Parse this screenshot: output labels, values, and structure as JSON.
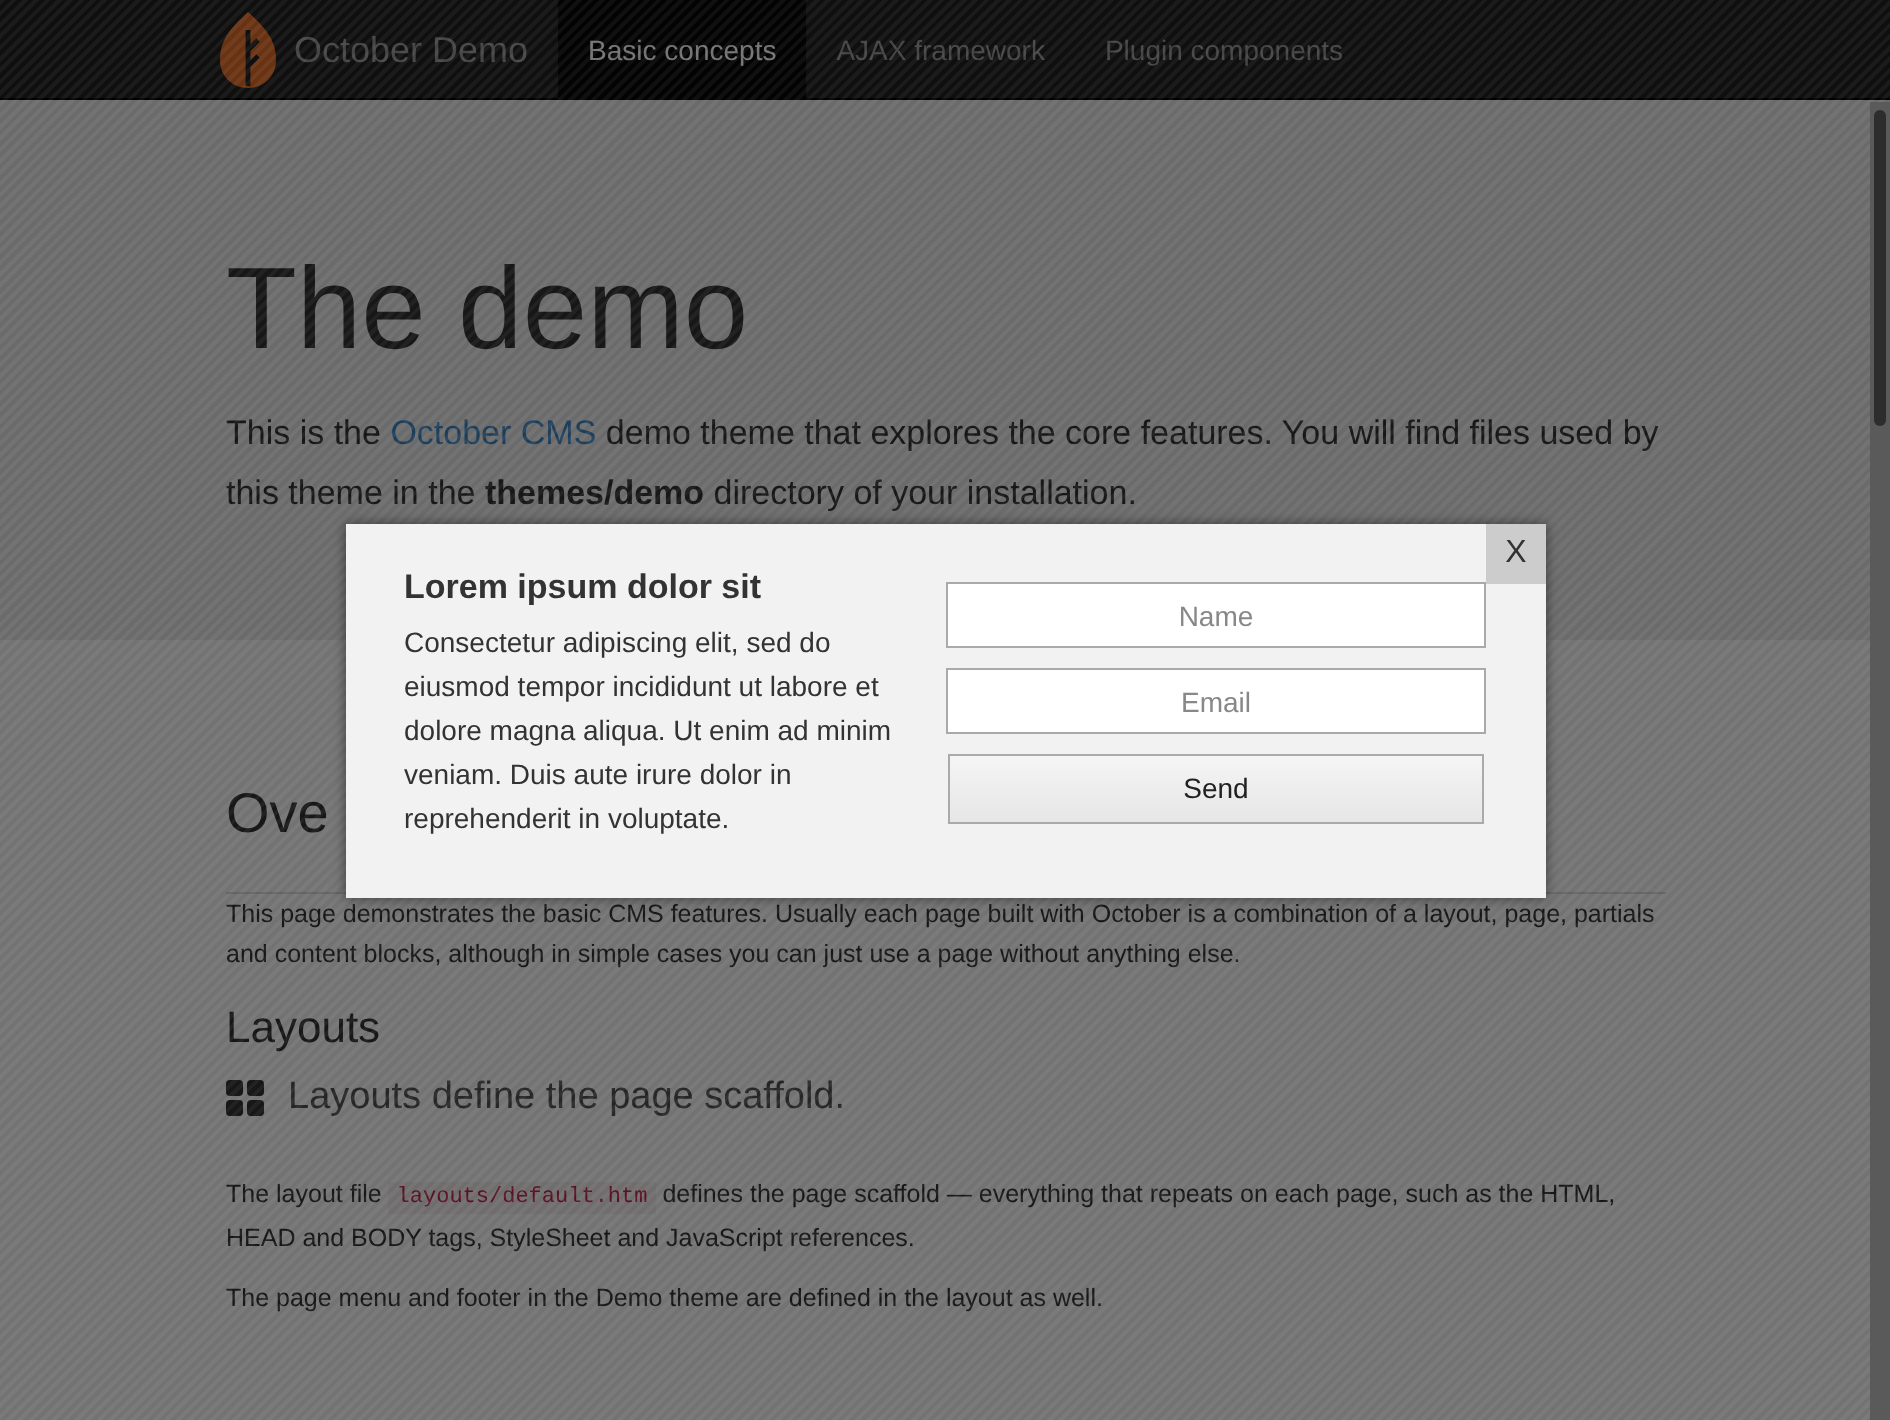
{
  "navbar": {
    "brand": "October Demo",
    "items": [
      {
        "label": "Basic concepts",
        "selected": true
      },
      {
        "label": "AJAX framework",
        "selected": false
      },
      {
        "label": "Plugin components",
        "selected": false
      }
    ]
  },
  "hero": {
    "title": "The demo",
    "lead_before": "This is the ",
    "lead_link": "October CMS",
    "lead_after": " demo theme that explores the core features. You will find files used by this theme in the **themes/demo** directory of your installation."
  },
  "content": {
    "heading": "Ove",
    "intro": "This page demonstrates the basic CMS features. Usually each page built with October is a combination of a layout, page, partials and content blocks, although in simple cases you can just use a page without anything else.",
    "section_title": "Layouts",
    "section_subtitle": "Layouts define the page scaffold.",
    "paragraph_before": "The layout file ",
    "paragraph_code": "layouts/default.htm",
    "paragraph_after": " defines the page scaffold — everything that repeats on each page, such as the HTML, HEAD and BODY tags, StyleSheet and JavaScript references.",
    "paragraph_2": "The page menu and footer in the Demo theme are defined in the layout as well."
  },
  "modal": {
    "close": "X",
    "title": "Lorem ipsum dolor sit",
    "text": "Consectetur adipiscing elit, sed do eiusmod tempor incididunt ut labore et dolore magna aliqua. Ut enim ad minim veniam. Duis aute irure dolor in reprehenderit in voluptate.",
    "fields": [
      {
        "placeholder": "Name"
      },
      {
        "placeholder": "Email"
      }
    ],
    "button": "Send"
  }
}
